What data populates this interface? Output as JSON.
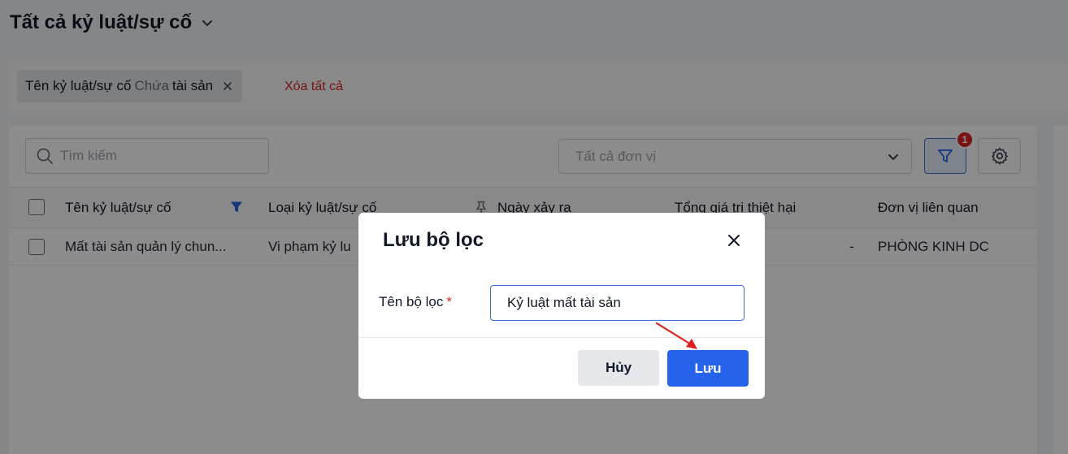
{
  "header": {
    "title": "Tất cả kỷ luật/sự cố"
  },
  "filters": {
    "chip": {
      "field": "Tên kỷ luật/sự cố",
      "operator": "Chứa",
      "value": "tài sản"
    },
    "clear_all": "Xóa tất cả"
  },
  "toolbar": {
    "search_placeholder": "Tìm kiếm",
    "unit_placeholder": "Tất cả đơn vị",
    "filter_badge": "1"
  },
  "table": {
    "columns": [
      "Tên kỷ luật/sự cố",
      "Loại kỷ luật/sự cố",
      "Ngày xảy ra",
      "Tổng giá trị thiệt hại",
      "Đơn vị liên quan"
    ],
    "rows": [
      {
        "name": "Mất tài sản quản lý chun...",
        "type": "Vi phạm kỷ lu",
        "date": "",
        "damage": "-",
        "unit": "PHÒNG KINH DC"
      }
    ]
  },
  "modal": {
    "title": "Lưu bộ lọc",
    "label": "Tên bộ lọc",
    "required_mark": "*",
    "input_value": "Kỷ luật mất tài sản",
    "cancel": "Hủy",
    "save": "Lưu"
  },
  "colors": {
    "primary": "#2563eb",
    "danger": "#dc2626",
    "arrow": "#e11d1d"
  },
  "icons": [
    "chevron-down-icon",
    "close-icon",
    "search-icon",
    "filter-icon",
    "gear-icon",
    "pin-icon"
  ]
}
